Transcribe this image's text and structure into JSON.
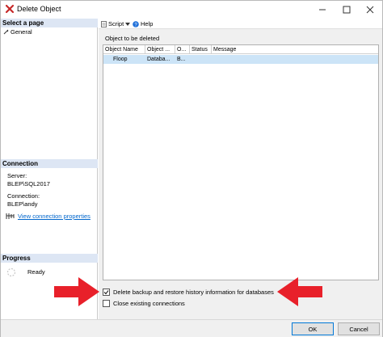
{
  "window": {
    "title": "Delete Object",
    "icon": "delete-x-icon"
  },
  "sidebar": {
    "select_page_header": "Select a page",
    "pages": [
      {
        "label": "General",
        "icon": "wrench-icon"
      }
    ],
    "connection_header": "Connection",
    "server_label": "Server:",
    "server_value": "BLEP\\SQL2017",
    "connection_label": "Connection:",
    "connection_value": "BLEP\\andy",
    "view_props_link": "View connection properties",
    "progress_header": "Progress",
    "progress_status": "Ready"
  },
  "toolbar": {
    "script_label": "Script",
    "help_label": "Help"
  },
  "main": {
    "objects_label": "Object to be deleted",
    "columns": [
      "Object Name",
      "Object ...",
      "O...",
      "Status",
      "Message"
    ],
    "rows": [
      {
        "name": "Floop",
        "type": "Databa...",
        "owner": "B...",
        "status": "",
        "message": ""
      }
    ],
    "option_backup_label": "Delete backup and restore history information for databases",
    "option_backup_checked": true,
    "option_close_label": "Close existing connections",
    "option_close_checked": false
  },
  "footer": {
    "ok_label": "OK",
    "cancel_label": "Cancel"
  },
  "colors": {
    "arrow": "#e8202a",
    "selection": "#cce4f7",
    "header": "#dde6f4",
    "link": "#0066cc"
  }
}
